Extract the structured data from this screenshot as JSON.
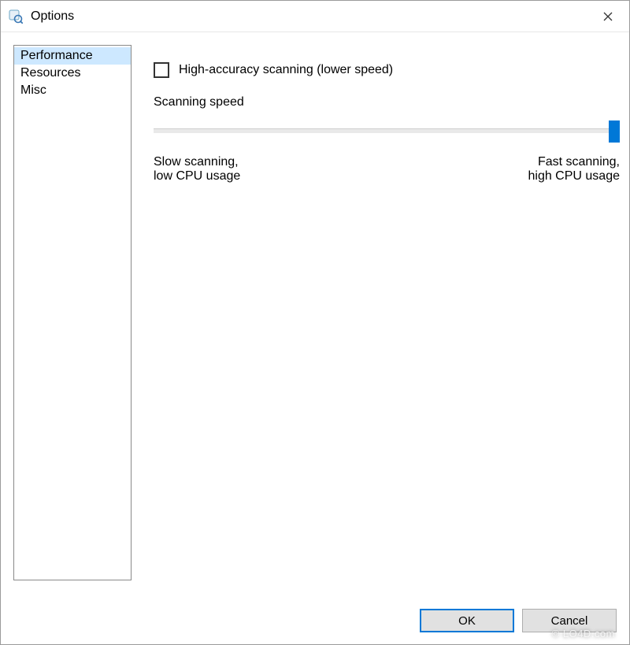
{
  "window": {
    "title": "Options"
  },
  "sidebar": {
    "items": [
      {
        "label": "Performance",
        "selected": true
      },
      {
        "label": "Resources",
        "selected": false
      },
      {
        "label": "Misc",
        "selected": false
      }
    ]
  },
  "panel": {
    "checkbox": {
      "checked": false,
      "label": "High-accuracy scanning (lower speed)"
    },
    "slider": {
      "label": "Scanning speed",
      "value": 100,
      "min": 0,
      "max": 100,
      "min_label_line1": "Slow scanning,",
      "min_label_line2": "low CPU usage",
      "max_label_line1": "Fast scanning,",
      "max_label_line2": "high CPU usage"
    }
  },
  "buttons": {
    "ok": "OK",
    "cancel": "Cancel"
  },
  "watermark": "© LO4D.com",
  "colors": {
    "accent": "#0078d7",
    "selection": "#cde8ff"
  }
}
